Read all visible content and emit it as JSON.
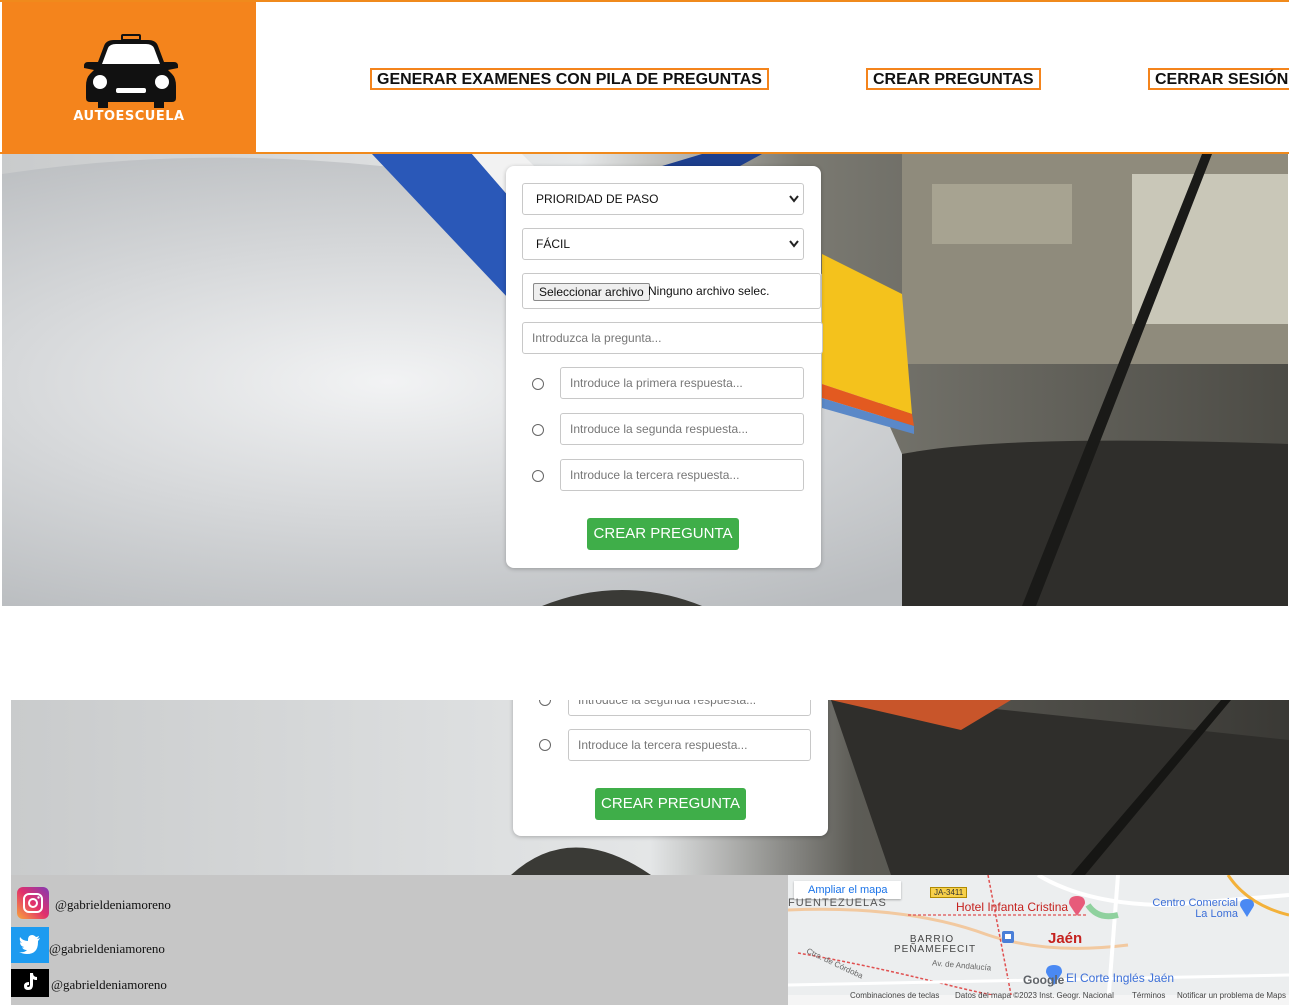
{
  "brand": {
    "name": "AUTOESCUELA",
    "accent": "#f4841c"
  },
  "nav": {
    "generar": "GENERAR EXAMENES CON PILA DE PREGUNTAS",
    "crear": "CREAR PREGUNTAS",
    "cerrar": "CERRAR SESIÓN"
  },
  "form": {
    "category_value": "PRIORIDAD DE PASO",
    "difficulty_value": "FÁCIL",
    "file_button": "Seleccionar archivo",
    "file_status": "Ninguno archivo selec.",
    "question_placeholder": "Introduzca la pregunta...",
    "answer1_placeholder": "Introduce la primera respuesta...",
    "answer2_placeholder": "Introduce la segunda respuesta...",
    "answer3_placeholder": "Introduce la tercera respuesta...",
    "submit_label": "CREAR PREGUNTA",
    "submit_color": "#3fae49"
  },
  "footer": {
    "instagram": "@gabrieldeniamoreno",
    "twitter": "@gabrieldeniamoreno",
    "tiktok": "@gabrieldeniamoreno",
    "icons": [
      "instagram-icon",
      "twitter-icon",
      "tiktok-icon"
    ]
  },
  "map": {
    "enlarge_link": "Ampliar el mapa",
    "road_label": "JA-3411",
    "neighborhood_top": "FUENTEZUELAS",
    "hotel": "Hotel Infanta Cristina",
    "mall": "Centro Comercial La Loma",
    "barrio": "BARRIO PEÑAMEFECIT",
    "city": "Jaén",
    "avenue": "Av. de Andalucía",
    "road_cord": "Ctra. de Córdoba",
    "store": "El Corte Inglés Jaén",
    "google_logo": "Google",
    "attribution": {
      "shortcuts": "Combinaciones de teclas",
      "data": "Datos del mapa ©2023 Inst. Geogr. Nacional",
      "terms": "Términos",
      "report": "Notificar un problema de Maps"
    }
  }
}
